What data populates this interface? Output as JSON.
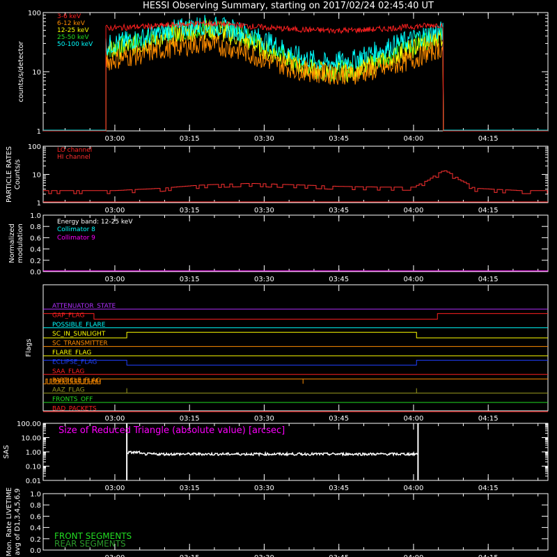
{
  "title": "HESSI Observing Summary, starting on 2017/02/24 02:45:40 UT",
  "time_ticks": [
    "03:00",
    "03:15",
    "03:30",
    "03:45",
    "04:00",
    "04:15"
  ],
  "colors": {
    "red": "#ff2020",
    "orange": "#ff8c00",
    "yellow": "#ffff00",
    "green": "#22dd22",
    "cyan": "#00ffff",
    "magenta": "#ff00ff",
    "purple": "#b030ff",
    "blue": "#2040ff",
    "white": "#ffffff",
    "olive": "#9a9a20",
    "crimson": "#ff3030"
  },
  "chart_data": [
    {
      "type": "line",
      "id": "count_rates",
      "ylabel": "counts/s/detector",
      "yscale": "log",
      "ylim": [
        1,
        100
      ],
      "ytick_labels": [
        "1",
        "10",
        "100"
      ],
      "x_unit": "UT time (decimal hours)",
      "x": [
        2.95,
        3.0,
        3.1,
        3.2,
        3.3,
        3.4,
        3.5,
        3.6,
        3.7,
        3.8,
        3.9,
        4.0,
        4.08
      ],
      "series": [
        {
          "name": "3-6 keV",
          "color": "#ff2020",
          "values": [
            55,
            55,
            58,
            62,
            66,
            62,
            56,
            52,
            50,
            50,
            53,
            58,
            62
          ]
        },
        {
          "name": "6-12 keV",
          "color": "#ff8c00",
          "values": [
            14,
            16,
            20,
            26,
            30,
            24,
            16,
            11,
            9,
            9,
            11,
            16,
            24
          ]
        },
        {
          "name": "12-25 keV",
          "color": "#ffff00",
          "values": [
            20,
            23,
            30,
            42,
            52,
            40,
            24,
            13,
            10,
            10,
            15,
            25,
            38
          ]
        },
        {
          "name": "25-50 keV",
          "color": "#22dd22",
          "values": [
            22,
            26,
            34,
            48,
            58,
            45,
            28,
            14,
            10,
            11,
            17,
            28,
            40
          ]
        },
        {
          "name": "50-100 keV",
          "color": "#00ffff",
          "values": [
            26,
            30,
            38,
            52,
            62,
            52,
            34,
            19,
            14,
            16,
            24,
            36,
            48
          ]
        }
      ],
      "observing_window": [
        "02:58",
        "04:06"
      ]
    },
    {
      "type": "line",
      "id": "particle_rates",
      "ylabel": "PARTICLE RATES Counts/s",
      "yscale": "log",
      "ylim": [
        1,
        100
      ],
      "ytick_labels": [
        "1",
        "10",
        "100"
      ],
      "series": [
        {
          "name": "LO channel",
          "color": "#ff2020",
          "values": [
            1,
            1,
            1,
            1,
            1,
            1,
            1,
            1,
            1,
            1,
            1,
            1,
            1
          ]
        },
        {
          "name": "HI channel",
          "color": "#ff3030",
          "x": [
            2.76,
            3.0,
            3.15,
            3.3,
            3.45,
            3.6,
            3.75,
            3.9,
            4.0,
            4.05,
            4.1,
            4.15,
            4.2,
            4.35
          ],
          "values": [
            2.5,
            2.5,
            3,
            4,
            4.5,
            4,
            3.5,
            3.3,
            3.3,
            6,
            13,
            6,
            3,
            2.5
          ]
        }
      ]
    },
    {
      "type": "line",
      "id": "modulation",
      "ylabel": "Normalized modulation",
      "ylim": [
        0.0,
        1.0
      ],
      "ytick_labels": [
        "0.0",
        "0.2",
        "0.4",
        "0.6",
        "0.8",
        "1.0"
      ],
      "annotation": "Energy band: 12-25 keV",
      "series": [
        {
          "name": "Collimator 8",
          "color": "#00ffff",
          "values": []
        },
        {
          "name": "Collimator 9",
          "color": "#ff00ff",
          "values": [
            0,
            0
          ]
        }
      ]
    },
    {
      "type": "line",
      "id": "flags",
      "ylabel": "Flags",
      "series": [
        {
          "name": "ATTENUATOR_STATE",
          "color": "#b030ff"
        },
        {
          "name": "GAP_FLAG",
          "color": "#ff2020"
        },
        {
          "name": "POSSIBLE_FLARE",
          "color": "#00ffff"
        },
        {
          "name": "SC_IN_SUNLIGHT",
          "color": "#ffff00"
        },
        {
          "name": "SC_TRANSMITTER",
          "color": "#ff8c00"
        },
        {
          "name": "FLARE_FLAG",
          "color": "#ffff00"
        },
        {
          "name": "ECLIPSE_FLAG",
          "color": "#2040ff"
        },
        {
          "name": "SAA_FLAG",
          "color": "#ff2020"
        },
        {
          "name": "PARTICLE_FLAG",
          "color": "#ff8c00"
        },
        {
          "name": "AAZ_FLAG",
          "color": "#9a9a20"
        },
        {
          "name": "FRONTS_OFF",
          "color": "#22dd22"
        },
        {
          "name": "BAD_PACKETS",
          "color": "#ff2020"
        }
      ]
    },
    {
      "type": "line",
      "id": "sas",
      "ylabel": "SAS",
      "yscale": "log",
      "ylim": [
        0.01,
        100
      ],
      "ytick_labels": [
        "0.01",
        "0.10",
        "1.00",
        "10.00",
        "100.00"
      ],
      "annotation": "Size of Reduced Triangle (absolute value) [arcsec]",
      "series": [
        {
          "name": "Size of Reduced Triangle",
          "color": "#ffffff",
          "x_range": [
            "03:03",
            "04:01"
          ],
          "typical_value": 0.7
        }
      ]
    },
    {
      "type": "line",
      "id": "livetime",
      "ylabel": "Mon. Rate LIVETIME avg of D1,3,4,5,6,9",
      "ylim": [
        0.0,
        1.0
      ],
      "ytick_labels": [
        "0.0",
        "0.2",
        "0.4",
        "0.6",
        "0.8",
        "1.0"
      ],
      "series": [
        {
          "name": "FRONT SEGMENTS",
          "color": "#22dd22",
          "values": []
        },
        {
          "name": "REAR SEGMENTS",
          "color": "#2a9a2a",
          "values": []
        }
      ]
    }
  ]
}
